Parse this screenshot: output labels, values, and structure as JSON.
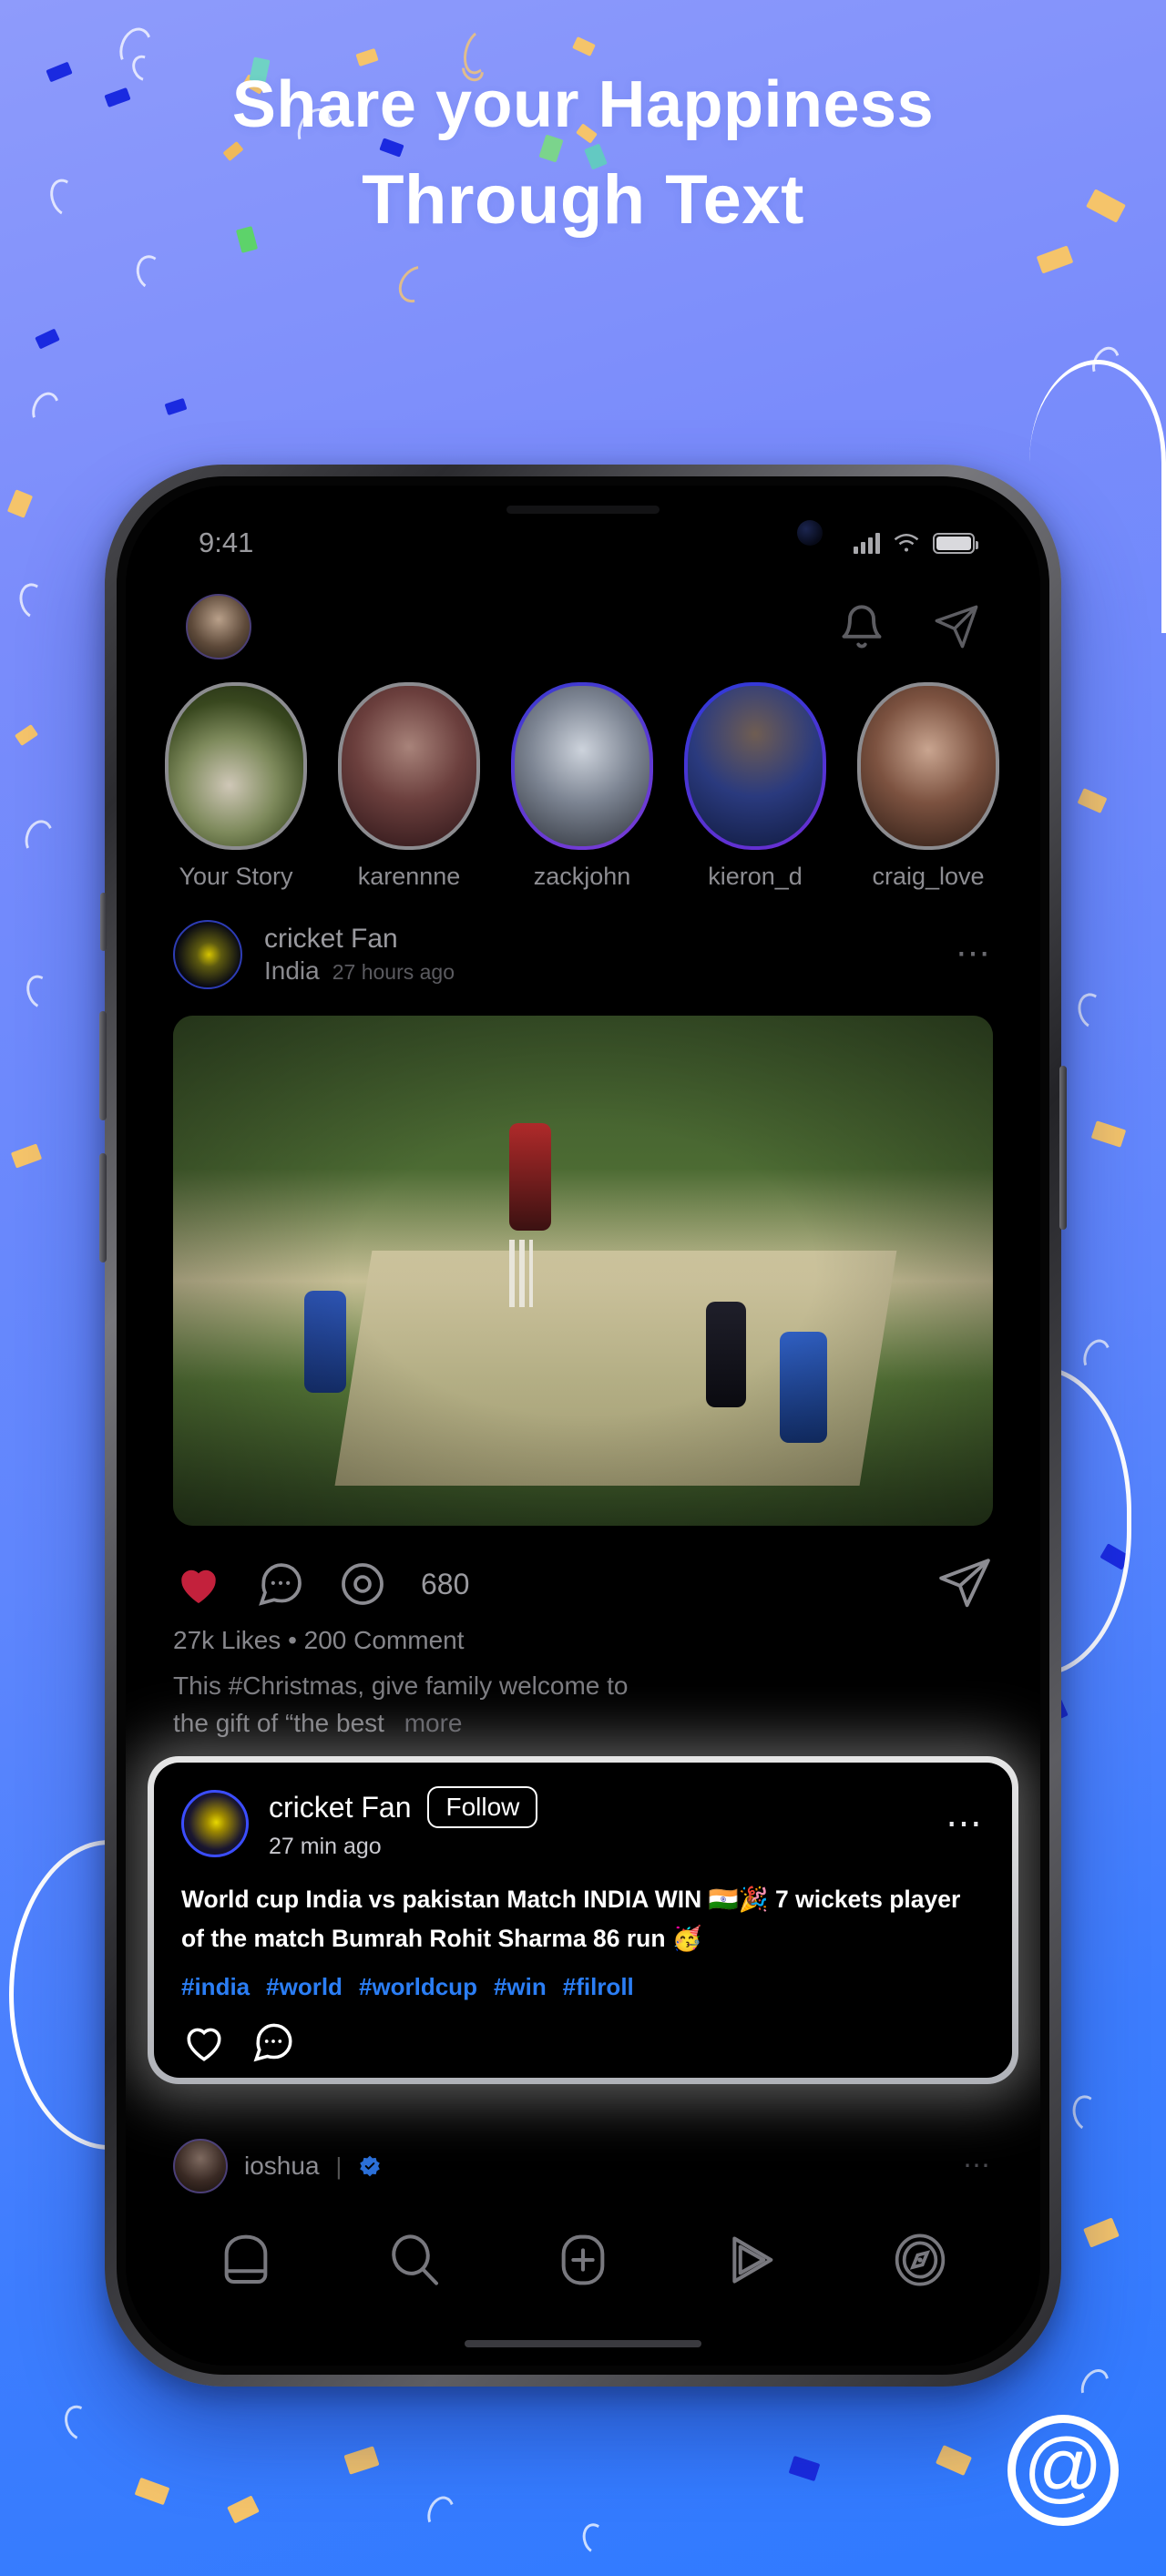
{
  "promo": {
    "headline_line1": "Share your Happiness",
    "headline_line2": "Through Text",
    "at_symbol": "@"
  },
  "statusbar": {
    "time": "9:41",
    "signal_icon": "cellular-signal-icon",
    "wifi_icon": "wifi-icon",
    "battery_icon": "battery-icon"
  },
  "app_header": {
    "avatar": "user-avatar",
    "notifications_icon": "bell-icon",
    "messages_icon": "send-message-icon"
  },
  "stories": [
    {
      "name": "Your Story",
      "has_ring": false
    },
    {
      "name": "karennne",
      "has_ring": false
    },
    {
      "name": "zackjohn",
      "has_ring": true
    },
    {
      "name": "kieron_d",
      "has_ring": true
    },
    {
      "name": "craig_love",
      "has_ring": false
    }
  ],
  "feed_post": {
    "author": "cricket Fan",
    "location": "India",
    "time": "27 hours ago",
    "more_icon": "ellipsis-icon",
    "like_icon": "heart-icon",
    "comment_icon": "comment-icon",
    "views_icon": "views-eye-icon",
    "views_count": "680",
    "share_icon": "share-icon",
    "stats": "27k Likes • 200 Comment",
    "caption_line1": "This #Christmas, give family   welcome to",
    "caption_line2": "the gift of “the best",
    "more_label": "more"
  },
  "highlight_card": {
    "author": "cricket Fan",
    "follow_label": "Follow",
    "time": "27 min ago",
    "more_icon": "ellipsis-icon",
    "body_line1": "World cup India vs pakistan Match INDIA WIN 🇮🇳🎉 7 wickets player",
    "body_line2": "of the match Bumrah Rohit Sharma 86 run 🥳",
    "hashtags": [
      "#india",
      "#world",
      "#worldcup",
      "#win",
      "#filroll"
    ],
    "like_icon": "heart-icon",
    "comment_icon": "comment-icon"
  },
  "next_post": {
    "author": "ioshua",
    "separator": "|",
    "verified_icon": "verified-badge-icon",
    "more_icon": "ellipsis-icon"
  },
  "bottom_nav": [
    {
      "name": "home-icon"
    },
    {
      "name": "search-icon"
    },
    {
      "name": "add-post-icon"
    },
    {
      "name": "reels-play-icon"
    },
    {
      "name": "explore-compass-icon"
    }
  ],
  "colors": {
    "background_start": "#8e9bfb",
    "background_end": "#2f7aff",
    "accent_blue": "#2b7ef5",
    "heart_red": "#c3213c",
    "card_white": "#ffffff"
  }
}
